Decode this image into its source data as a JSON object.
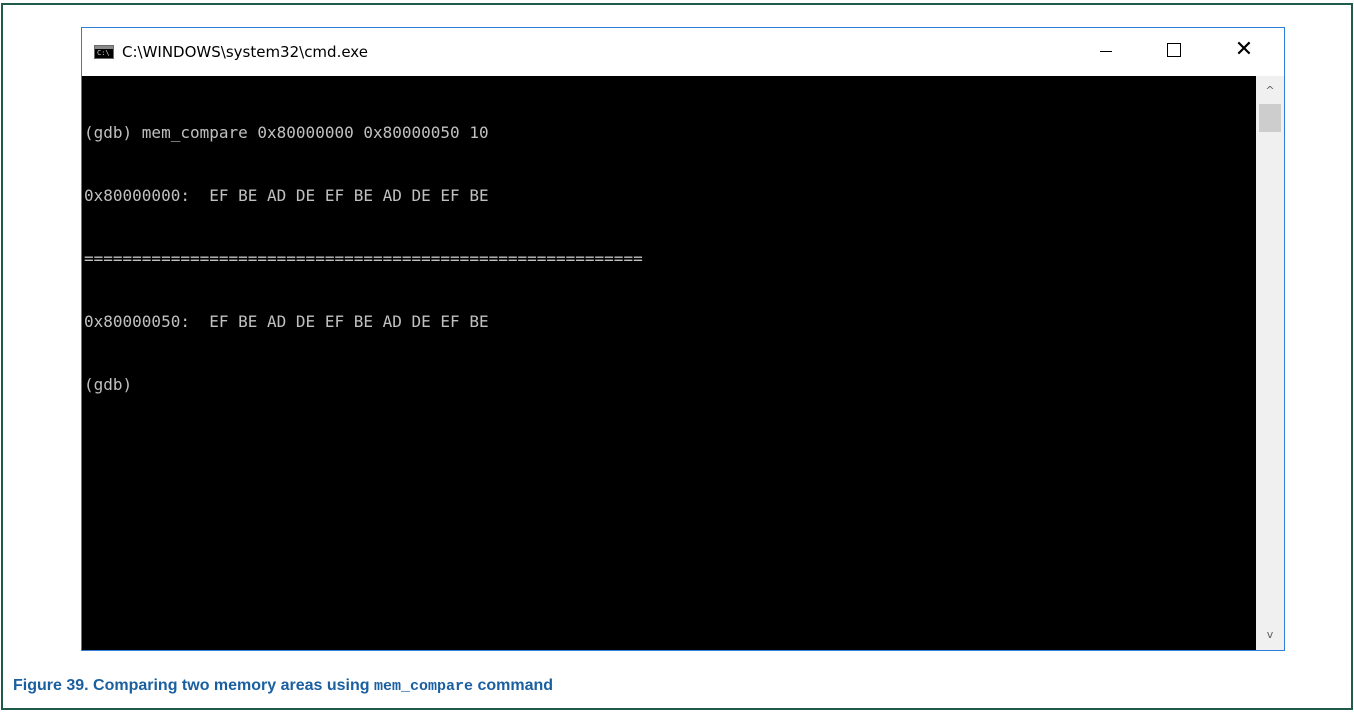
{
  "window": {
    "title": "C:\\WINDOWS\\system32\\cmd.exe",
    "icon_text": "C:\\"
  },
  "controls": {
    "minimize_icon": "minimize-icon",
    "maximize_icon": "maximize-icon",
    "close_icon": "close-icon",
    "close_glyph": "✕"
  },
  "console": {
    "background": "#000000",
    "foreground": "#c0c0c0",
    "lines": [
      "(gdb) mem_compare 0x80000000 0x80000050 10",
      "0x80000000:  EF BE AD DE EF BE AD DE EF BE",
      "==========================================================",
      "0x80000050:  EF BE AD DE EF BE AD DE EF BE",
      "(gdb)"
    ]
  },
  "scrollbar": {
    "up_glyph": "^",
    "down_glyph": "v"
  },
  "caption": {
    "prefix": "Figure 39. Comparing two memory areas using ",
    "code": "mem_compare",
    "suffix": " command",
    "color": "#1a5fa0"
  }
}
